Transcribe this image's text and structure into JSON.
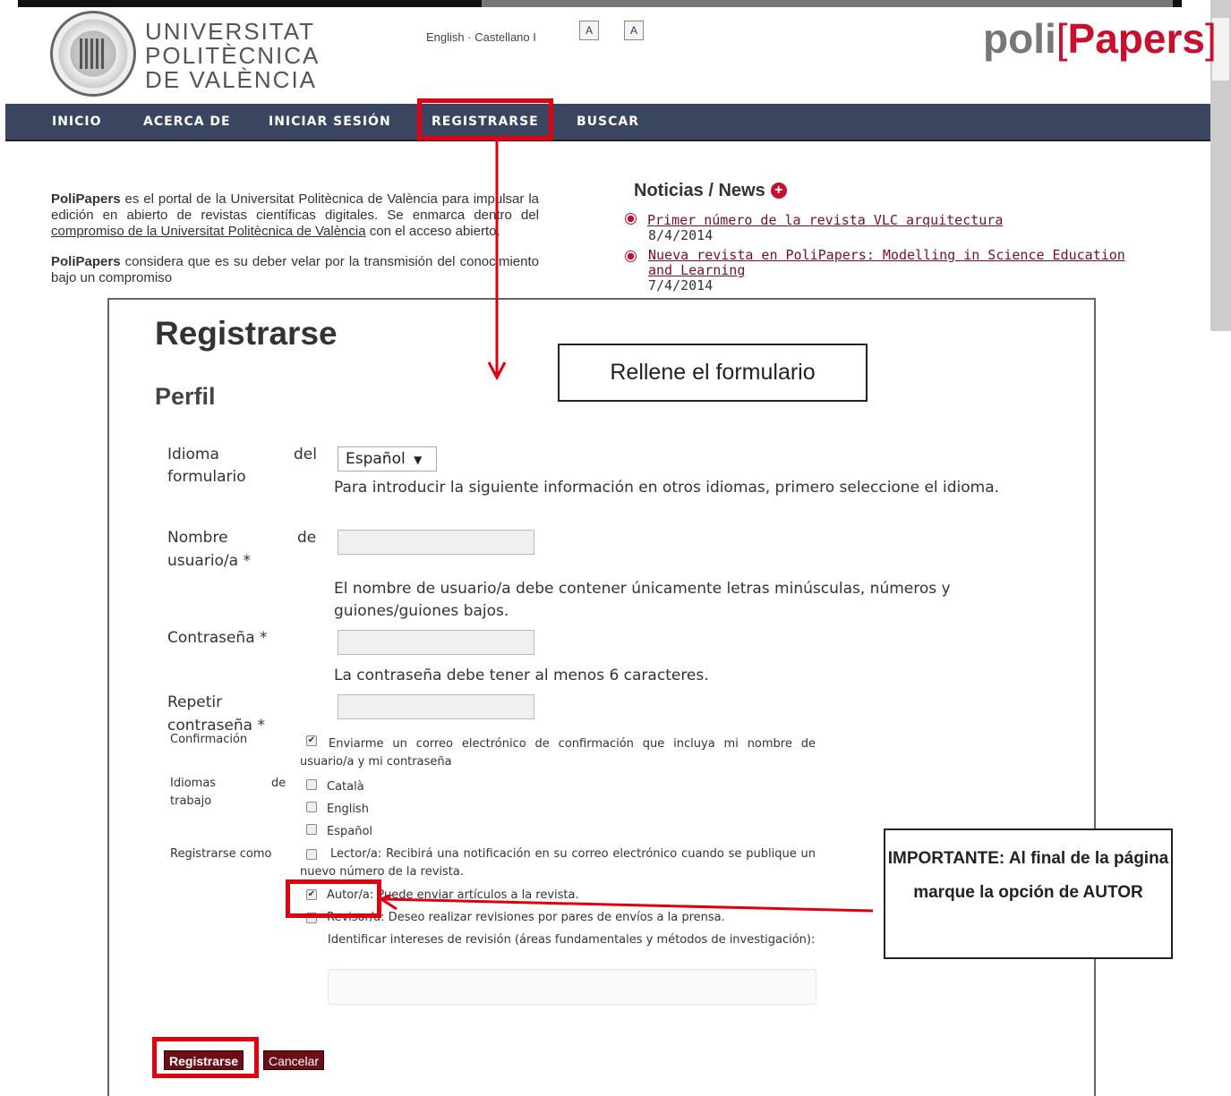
{
  "header": {
    "university_lines": [
      "UNIVERSITAT",
      "POLITÈCNICA",
      "DE VALÈNCIA"
    ],
    "language_links": {
      "english": "English",
      "separator": " · ",
      "castellano": "Castellano",
      "pipe": " I"
    },
    "font_buttons": [
      "A",
      "A"
    ],
    "logo": {
      "prefix": "poli",
      "open_bracket": "[",
      "brand": "Papers",
      "close_bracket": "]"
    }
  },
  "nav": [
    "INICIO",
    "ACERCA DE",
    "INICIAR SESIÓN",
    "REGISTRARSE",
    "BUSCAR"
  ],
  "intro": {
    "p1_brand": "PoliPapers",
    "p1_text_a": " es el portal de la Universitat Politècnica de València para impulsar la edición en abierto de revistas científicas digitales. Se enmarca dentro del ",
    "p1_link": "compromiso de la Universitat Politècnica de València",
    "p1_text_b": " con el acceso abierto.",
    "p2_brand": "PoliPapers",
    "p2_text": " considera que es su deber velar por la transmisión del conocimiento bajo un compromiso"
  },
  "news": {
    "title": "Noticias / News",
    "items": [
      {
        "title": "Primer número de la revista VLC arquitectura",
        "date": "8/4/2014"
      },
      {
        "title": "Nueva revista en PoliPapers: Modelling in Science Education and Learning",
        "date": "7/4/2014"
      }
    ]
  },
  "form": {
    "title": "Registrarse",
    "section": "Perfil",
    "language_label_a": "Idioma",
    "language_label_b": "del",
    "language_label_c": "formulario",
    "language_value": "Español",
    "language_hint": "Para introducir la siguiente información en otros idiomas, primero seleccione el idioma.",
    "username_label_a": "Nombre",
    "username_label_b": "de",
    "username_label_c": "usuario/a *",
    "username_hint": "El nombre de usuario/a debe contener únicamente letras minúsculas, números y guiones/guiones bajos.",
    "password_label": "Contraseña *",
    "password_hint": "La contraseña debe tener al menos 6 caracteres.",
    "repeat_label_a": "Repetir",
    "repeat_label_b": "contraseña *",
    "confirm_label": "Confirmación",
    "confirm_text": "Enviarme un correo electrónico de confirmación que incluya mi nombre de usuario/a y mi contraseña",
    "work_lang_label_a": "Idiomas",
    "work_lang_label_b": "de",
    "work_lang_label_c": "trabajo",
    "work_langs": [
      "Català",
      "English",
      "Español"
    ],
    "register_as_label": "Registrarse como",
    "reader_role": "Lector/a",
    "reader_desc": ": Recibirá una notificación en su correo electrónico cuando se publique un nuevo número de la revista.",
    "author_role": "Autor/a",
    "author_desc": ": Puede enviar artículos a la revista.",
    "reviewer_role": "Revisor/a",
    "reviewer_desc": ": Deseo realizar revisiones por pares de envíos a la prensa.",
    "reviewer_interests": "Identificar intereses de revisión (áreas fundamentales y métodos de investigación):",
    "submit_label": "Registrarse",
    "cancel_label": "Cancelar"
  },
  "annotations": {
    "fill_form": "Rellene el formulario",
    "important": "IMPORTANTE: Al final de la página marque la opción de AUTOR"
  },
  "colors": {
    "nav_bg": "#3a4560",
    "brand_red": "#c8102e",
    "highlight_red": "#e00010",
    "button_bg": "#6b0f16"
  }
}
